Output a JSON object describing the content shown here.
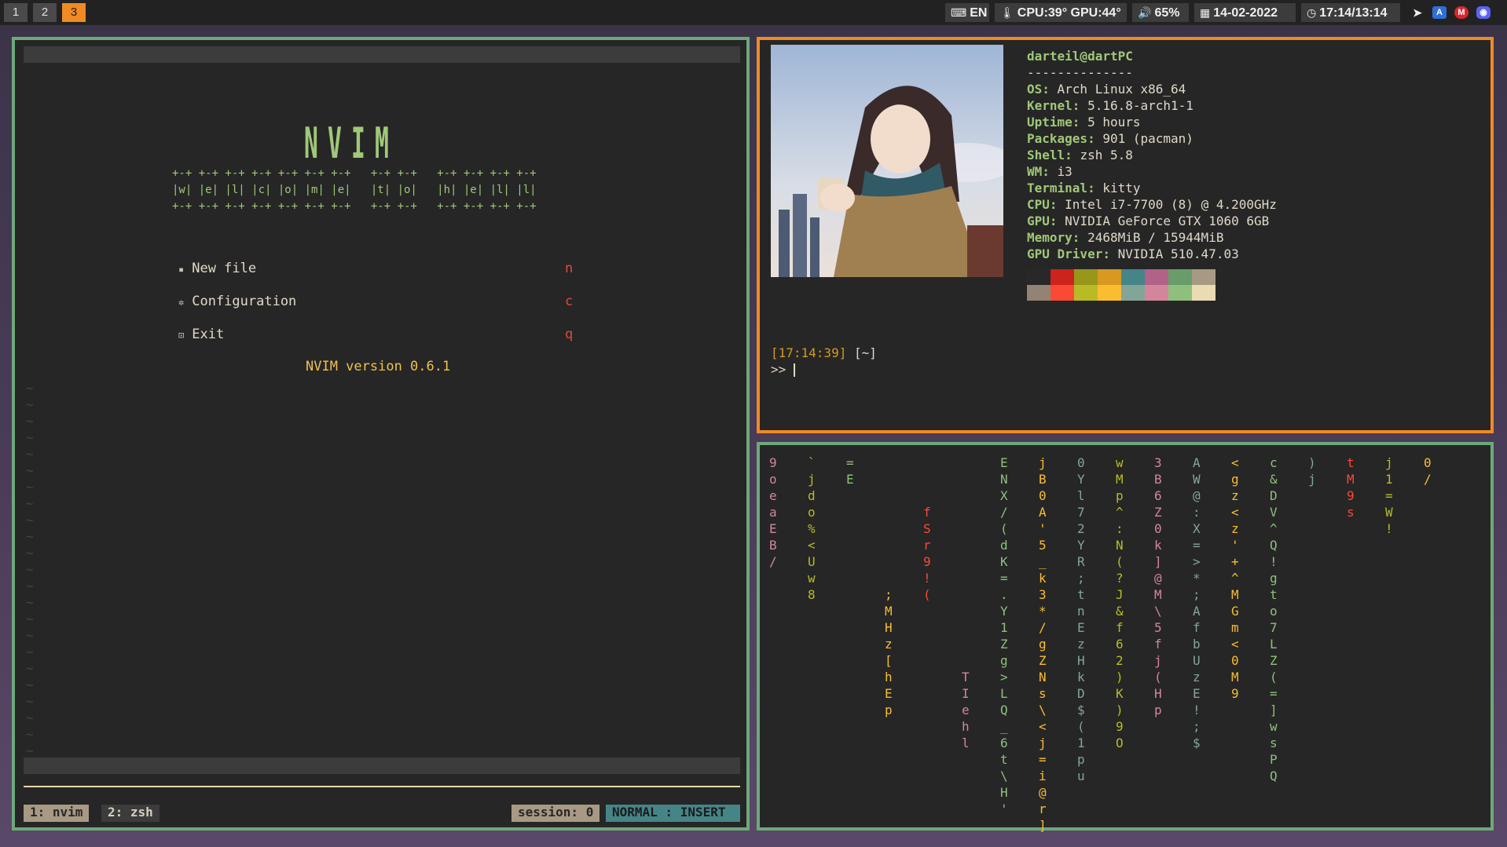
{
  "topbar": {
    "workspaces": [
      "1",
      "2",
      "3"
    ],
    "active_workspace": "3",
    "keyboard": "EN",
    "temps": "CPU:39° GPU:44°",
    "volume": "65%",
    "date": "14-02-2022",
    "time": "17:14/13:14",
    "tray_icons": [
      "telegram-icon",
      "translate-icon",
      "mega-icon",
      "discord-icon"
    ]
  },
  "nvim": {
    "logo": "NVIM",
    "ascii_row1": "+-+ +-+ +-+ +-+ +-+ +-+ +-+   +-+ +-+   +-+ +-+ +-+ +-+",
    "ascii_row2": "|w| |e| |l| |c| |o| |m| |e|   |t| |o|   |h| |e| |l| |l|",
    "ascii_row3": "+-+ +-+ +-+ +-+ +-+ +-+ +-+   +-+ +-+   +-+ +-+ +-+ +-+",
    "menu": [
      {
        "label": "New file",
        "key": "n"
      },
      {
        "label": "Configuration",
        "key": "c"
      },
      {
        "label": "Exit",
        "key": "q"
      }
    ],
    "version": "NVIM version 0.6.1"
  },
  "tmux": {
    "tabs": [
      "1: nvim",
      "2: zsh"
    ],
    "session": "session: 0",
    "mode": "NORMAL : INSERT"
  },
  "neofetch": {
    "header": "darteil@dartPC",
    "separator": "--------------",
    "fields": [
      {
        "k": "OS",
        "v": "Arch Linux x86_64"
      },
      {
        "k": "Kernel",
        "v": "5.16.8-arch1-1"
      },
      {
        "k": "Uptime",
        "v": "5 hours"
      },
      {
        "k": "Packages",
        "v": "901 (pacman)"
      },
      {
        "k": "Shell",
        "v": "zsh 5.8"
      },
      {
        "k": "WM",
        "v": "i3"
      },
      {
        "k": "Terminal",
        "v": "kitty"
      },
      {
        "k": "CPU",
        "v": "Intel i7-7700 (8) @ 4.200GHz"
      },
      {
        "k": "GPU",
        "v": "NVIDIA GeForce GTX 1060 6GB"
      },
      {
        "k": "Memory",
        "v": "2468MiB / 15944MiB"
      },
      {
        "k": "GPU Driver",
        "v": "NVIDIA 510.47.03"
      }
    ],
    "palette_top": [
      "#282828",
      "#cc241d",
      "#98971a",
      "#d79921",
      "#458588",
      "#b16286",
      "#689d6a",
      "#a89984"
    ],
    "palette_bottom": [
      "#928374",
      "#fb4934",
      "#b8bb26",
      "#fabd2f",
      "#83a598",
      "#d3869b",
      "#8ec07c",
      "#ebdbb2"
    ],
    "prompt_time": "[17:14:39]",
    "prompt_dir": "[~]",
    "prompt": ">>"
  },
  "matrix": {
    "columns": [
      {
        "chars": "9oeaEB/",
        "color": "#d3869b"
      },
      {
        "chars": "`jdo%<Uw8",
        "color": "#b8bb26"
      },
      {
        "chars": "=E",
        "color": "#8ec07c"
      },
      {
        "chars": ";MHz[hEp",
        "color": "#fabd2f"
      },
      {
        "chars": "fSr9!(",
        "color": "#fb4934"
      },
      {
        "chars": "TIehl",
        "color": "#d3869b"
      },
      {
        "chars": "ENX/(dK=.Y1Zg>LQ_6t\\H'",
        "color": "#8ec07c"
      },
      {
        "chars": "jB0A'5_k3*/gZNs\\<j=i@r]",
        "color": "#fabd2f"
      },
      {
        "chars": "0Yl72YR;tnEzHkD$(1pu",
        "color": "#83a598"
      },
      {
        "chars": "wMp^:N(?J&f62)K)9O",
        "color": "#b8bb26"
      },
      {
        "chars": "3B6Z0k]@M\\5fj(Hp",
        "color": "#d3869b"
      },
      {
        "chars": "AW@:X=>*;AfbUzE!;$",
        "color": "#83a598"
      },
      {
        "chars": "<gz<z'+^MGm<0M9",
        "color": "#fabd2f"
      },
      {
        "chars": "c&DV^Q!gto7LZ(=]wsPQ",
        "color": "#8ec07c"
      },
      {
        "chars": ")j",
        "color": "#83a598"
      },
      {
        "chars": "tM9s",
        "color": "#fb4934"
      },
      {
        "chars": "j1=W!",
        "color": "#b8bb26"
      },
      {
        "chars": "0/",
        "color": "#fabd2f"
      }
    ]
  }
}
